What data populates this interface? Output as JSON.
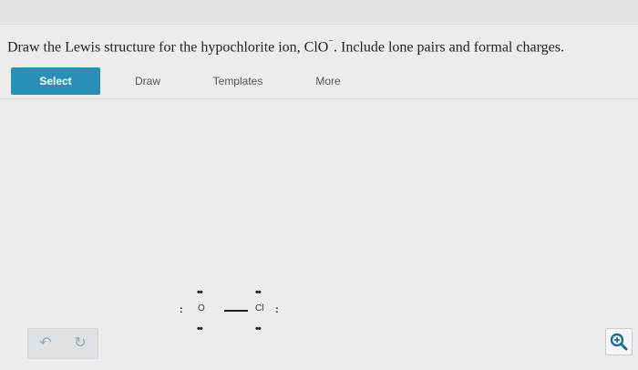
{
  "question": {
    "prefix": "Draw the Lewis structure for the hypochlorite ion, ClO",
    "charge": "−",
    "suffix": ". Include lone pairs and formal charges."
  },
  "toolbar": {
    "select_label": "Select",
    "draw_label": "Draw",
    "templates_label": "Templates",
    "more_label": "More"
  },
  "molecule": {
    "atom1": "O",
    "atom2": "Cl",
    "lone_pair": ":",
    "vertical_pair": "••"
  },
  "controls": {
    "undo_icon": "↶",
    "redo_icon": "↻"
  },
  "colors": {
    "accent": "#2a8fb5"
  }
}
